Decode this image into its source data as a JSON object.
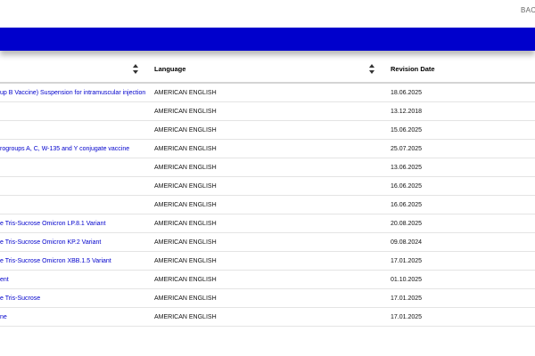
{
  "topbar": {
    "back_label": "BACK"
  },
  "table": {
    "headers": {
      "name": "",
      "language": "Language",
      "revision_date": "Revision Date"
    },
    "rows": [
      {
        "name": "up B Vaccine) Suspension for intramuscular injection",
        "language": "AMERICAN ENGLISH",
        "revision_date": "18.06.2025"
      },
      {
        "name": "",
        "language": "AMERICAN ENGLISH",
        "revision_date": "13.12.2018"
      },
      {
        "name": "",
        "language": "AMERICAN ENGLISH",
        "revision_date": "15.06.2025"
      },
      {
        "name": "rogroups A, C, W-135 and Y conjugate vaccine",
        "language": "AMERICAN ENGLISH",
        "revision_date": "25.07.2025"
      },
      {
        "name": "",
        "language": "AMERICAN ENGLISH",
        "revision_date": "13.06.2025"
      },
      {
        "name": "",
        "language": "AMERICAN ENGLISH",
        "revision_date": "16.06.2025"
      },
      {
        "name": "",
        "language": "AMERICAN ENGLISH",
        "revision_date": "16.06.2025"
      },
      {
        "name": "e Tris-Sucrose Omicron LP.8.1 Variant",
        "language": "AMERICAN ENGLISH",
        "revision_date": "20.08.2025"
      },
      {
        "name": "e Tris-Sucrose Omicron KP.2 Variant",
        "language": "AMERICAN ENGLISH",
        "revision_date": "09.08.2024"
      },
      {
        "name": "e Tris-Sucrose Omicron XBB.1.5 Variant",
        "language": "AMERICAN ENGLISH",
        "revision_date": "17.01.2025"
      },
      {
        "name": "ent",
        "language": "AMERICAN ENGLISH",
        "revision_date": "01.10.2025"
      },
      {
        "name": "e Tris-Sucrose",
        "language": "AMERICAN ENGLISH",
        "revision_date": "17.01.2025"
      },
      {
        "name": "ne",
        "language": "AMERICAN ENGLISH",
        "revision_date": "17.01.2025"
      }
    ]
  },
  "colors": {
    "brand_bar": "#0000cc",
    "link": "#0000cc"
  }
}
